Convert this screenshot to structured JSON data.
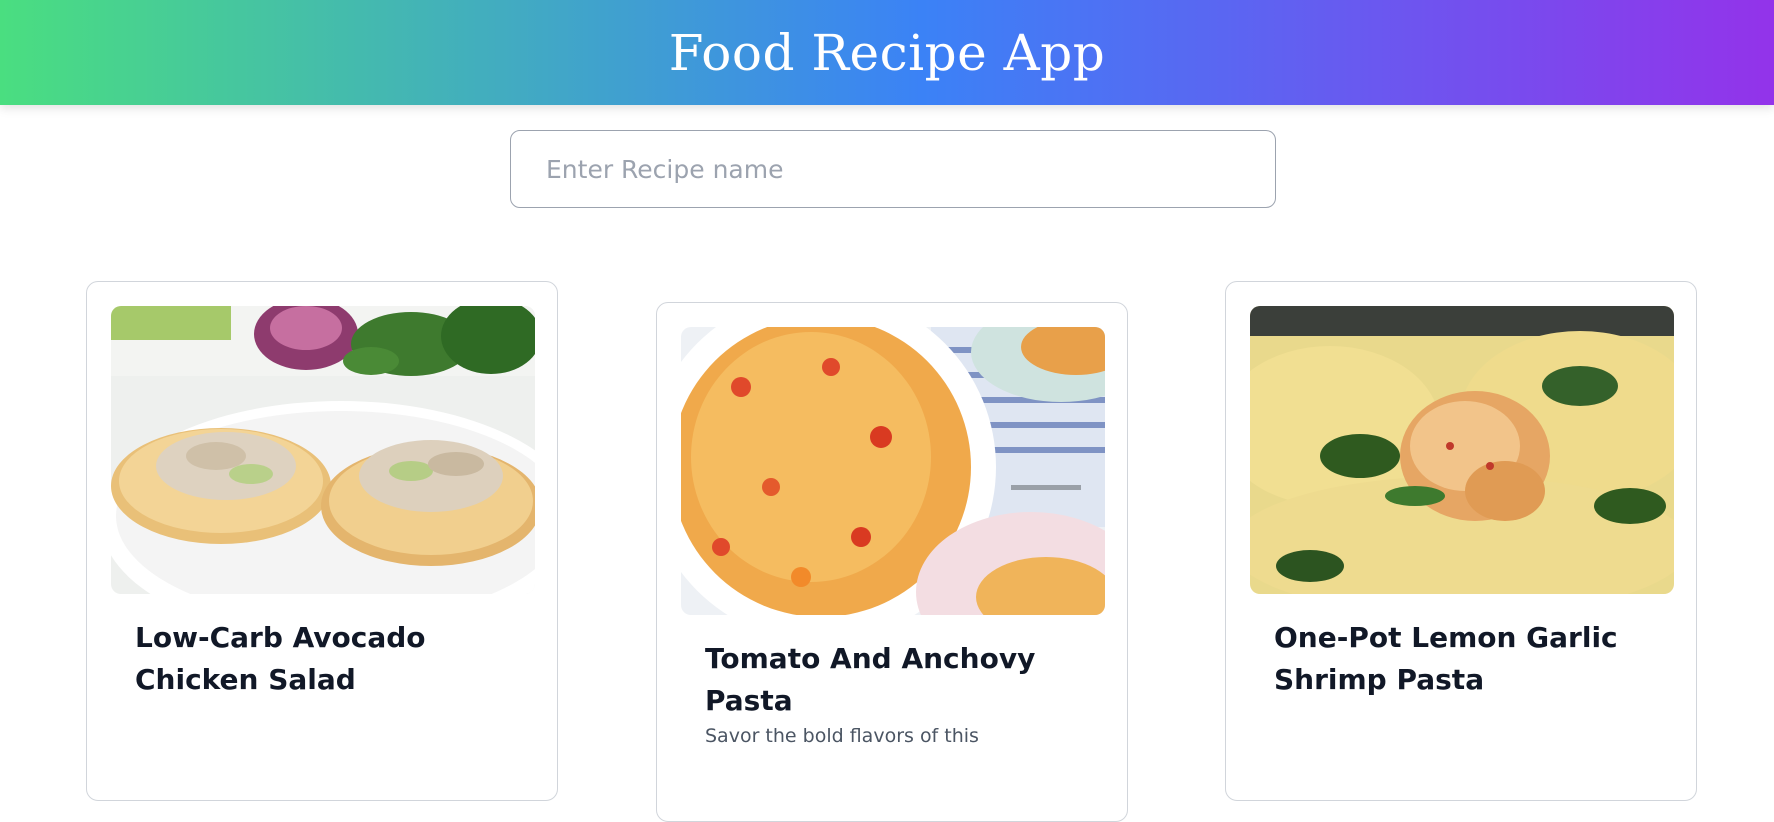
{
  "header": {
    "title": "Food Recipe App"
  },
  "search": {
    "placeholder": "Enter Recipe name",
    "value": ""
  },
  "recipes": [
    {
      "title": "Low-Carb Avocado Chicken Salad",
      "description": "",
      "image_icon": "chicken-salad-photo"
    },
    {
      "title": "Tomato And Anchovy Pasta",
      "description": "Savor the bold flavors of this",
      "image_icon": "tomato-pasta-photo"
    },
    {
      "title": "One-Pot Lemon Garlic Shrimp Pasta",
      "description": "",
      "image_icon": "shrimp-pasta-photo"
    }
  ],
  "colors": {
    "header_gradient": [
      "#4ade80",
      "#3b82f6",
      "#9333ea"
    ],
    "title_text": "#111827",
    "card_border": "#d1d5db"
  }
}
